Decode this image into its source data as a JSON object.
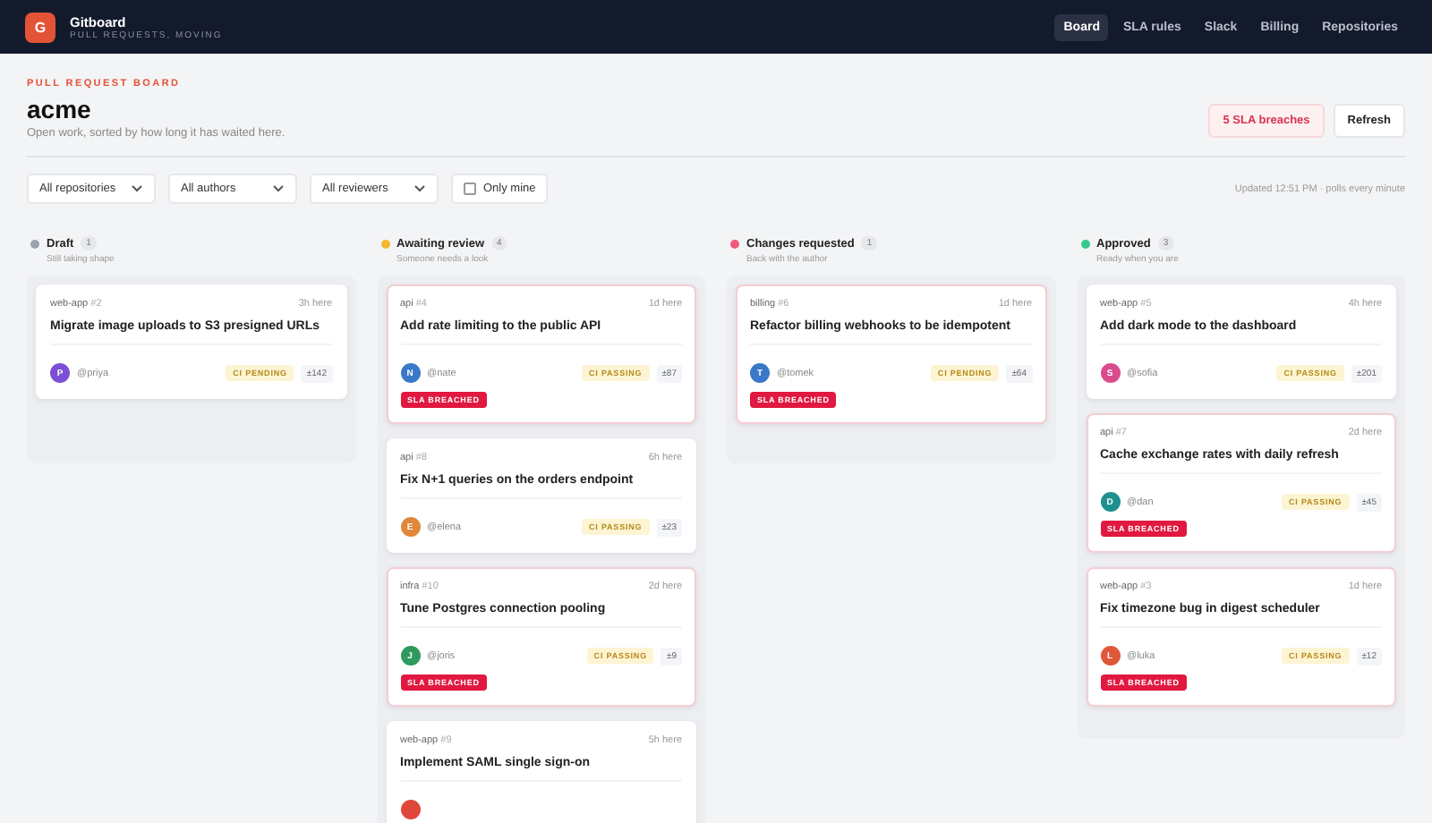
{
  "app": {
    "name": "Gitboard",
    "tagline": "PULL REQUESTS, MOVING",
    "logo_letter": "G"
  },
  "nav": [
    {
      "label": "Board",
      "selected": true
    },
    {
      "label": "SLA rules",
      "selected": false
    },
    {
      "label": "Slack",
      "selected": false
    },
    {
      "label": "Billing",
      "selected": false
    },
    {
      "label": "Repositories",
      "selected": false
    }
  ],
  "page": {
    "eyebrow": "PULL REQUEST BOARD",
    "title": "acme",
    "subtitle": "Open work, sorted by how long it has waited here.",
    "breaches": "5 SLA breaches",
    "refresh": "Refresh"
  },
  "filters": {
    "selects": [
      "All repositories",
      "All authors",
      "All reviewers"
    ],
    "only_mine": {
      "label": "Only mine",
      "checked": false
    },
    "updated": "Updated 12:51 PM · polls every minute"
  },
  "columns": [
    {
      "title": "Draft",
      "count": "1",
      "hint": "Still taking shape",
      "color": "#9ca3af",
      "cards": [
        {
          "repo": "web-app",
          "number": "#2",
          "age": "3h here",
          "title": "Migrate image uploads to S3 presigned URLs",
          "avatar": "P",
          "color": "#7c4fd6",
          "author": "@priya",
          "ci": "CI PENDING",
          "diff": "±142",
          "breached": false
        }
      ]
    },
    {
      "title": "Awaiting review",
      "count": "4",
      "hint": "Someone needs a look",
      "color": "#f5b82e",
      "cards": [
        {
          "repo": "api",
          "number": "#4",
          "age": "1d here",
          "title": "Add rate limiting to the public API",
          "avatar": "N",
          "color": "#3a78c9",
          "author": "@nate",
          "ci": "CI PASSING",
          "diff": "±87",
          "breached": true,
          "breach_label": "SLA BREACHED"
        },
        {
          "repo": "api",
          "number": "#8",
          "age": "6h here",
          "title": "Fix N+1 queries on the orders endpoint",
          "avatar": "E",
          "color": "#e0873a",
          "author": "@elena",
          "ci": "CI PASSING",
          "diff": "±23",
          "breached": false
        },
        {
          "repo": "infra",
          "number": "#10",
          "age": "2d here",
          "title": "Tune Postgres connection pooling",
          "avatar": "J",
          "color": "#2f9a5e",
          "author": "@joris",
          "ci": "CI PASSING",
          "diff": "±9",
          "breached": true,
          "breach_label": "SLA BREACHED"
        },
        {
          "repo": "web-app",
          "number": "#9",
          "age": "5h here",
          "title": "Implement SAML single sign-on",
          "color": "#e0473a",
          "breached": false
        }
      ]
    },
    {
      "title": "Changes requested",
      "count": "1",
      "hint": "Back with the author",
      "color": "#f05a7e",
      "cards": [
        {
          "repo": "billing",
          "number": "#6",
          "age": "1d here",
          "title": "Refactor billing webhooks to be idempotent",
          "avatar": "T",
          "color": "#3a78c9",
          "author": "@tomek",
          "ci": "CI PENDING",
          "diff": "±64",
          "breached": true,
          "breach_label": "SLA BREACHED"
        }
      ]
    },
    {
      "title": "Approved",
      "count": "3",
      "hint": "Ready when you are",
      "color": "#34c98a",
      "cards": [
        {
          "repo": "web-app",
          "number": "#5",
          "age": "4h here",
          "title": "Add dark mode to the dashboard",
          "avatar": "S",
          "color": "#d94b8c",
          "author": "@sofia",
          "ci": "CI PASSING",
          "diff": "±201",
          "breached": false
        },
        {
          "repo": "api",
          "number": "#7",
          "age": "2d here",
          "title": "Cache exchange rates with daily refresh",
          "avatar": "D",
          "color": "#1f8f8f",
          "author": "@dan",
          "ci": "CI PASSING",
          "diff": "±45",
          "breached": true,
          "breach_label": "SLA BREACHED"
        },
        {
          "repo": "web-app",
          "number": "#3",
          "age": "1d here",
          "title": "Fix timezone bug in digest scheduler",
          "avatar": "L",
          "color": "#e0573a",
          "author": "@luka",
          "ci": "CI PASSING",
          "diff": "±12",
          "breached": true,
          "breach_label": "SLA BREACHED"
        }
      ]
    }
  ]
}
